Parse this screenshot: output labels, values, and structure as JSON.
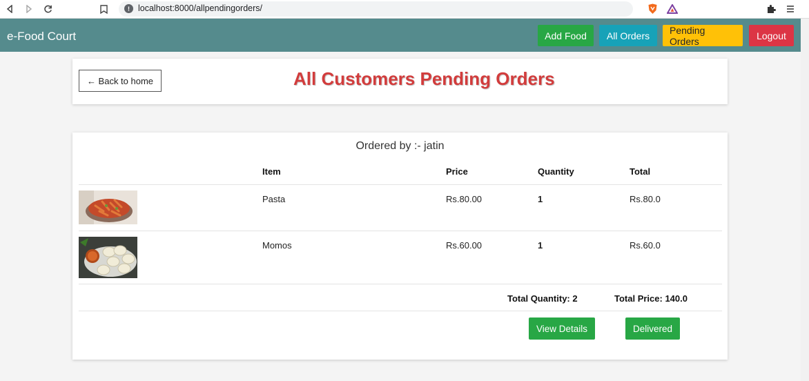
{
  "browser": {
    "url": "localhost:8000/allpendingorders/",
    "info_glyph": "!"
  },
  "navbar": {
    "brand": "e-Food Court",
    "add_food": "Add Food",
    "all_orders": "All Orders",
    "pending_orders": "Pending Orders",
    "logout": "Logout",
    "colors": {
      "bar": "#558b8d",
      "add": "#28a745",
      "all": "#17a2b8",
      "pending": "#ffc107",
      "logout": "#dc3545"
    }
  },
  "header": {
    "back_label": "← Back to home",
    "title": "All Customers Pending Orders",
    "title_color": "#d23c3c"
  },
  "order": {
    "ordered_by": "Ordered by :- jatin",
    "columns": {
      "item": "Item",
      "price": "Price",
      "quantity": "Quantity",
      "total": "Total"
    },
    "rows": [
      {
        "image": "pasta-photo",
        "item": "Pasta",
        "price": "Rs.80.00",
        "quantity": "1",
        "total": "Rs.80.0"
      },
      {
        "image": "momos-photo",
        "item": "Momos",
        "price": "Rs.60.00",
        "quantity": "1",
        "total": "Rs.60.0"
      }
    ],
    "total_quantity": "Total Quantity: 2",
    "total_price": "Total Price: 140.0",
    "view_details": "View Details",
    "delivered": "Delivered"
  }
}
